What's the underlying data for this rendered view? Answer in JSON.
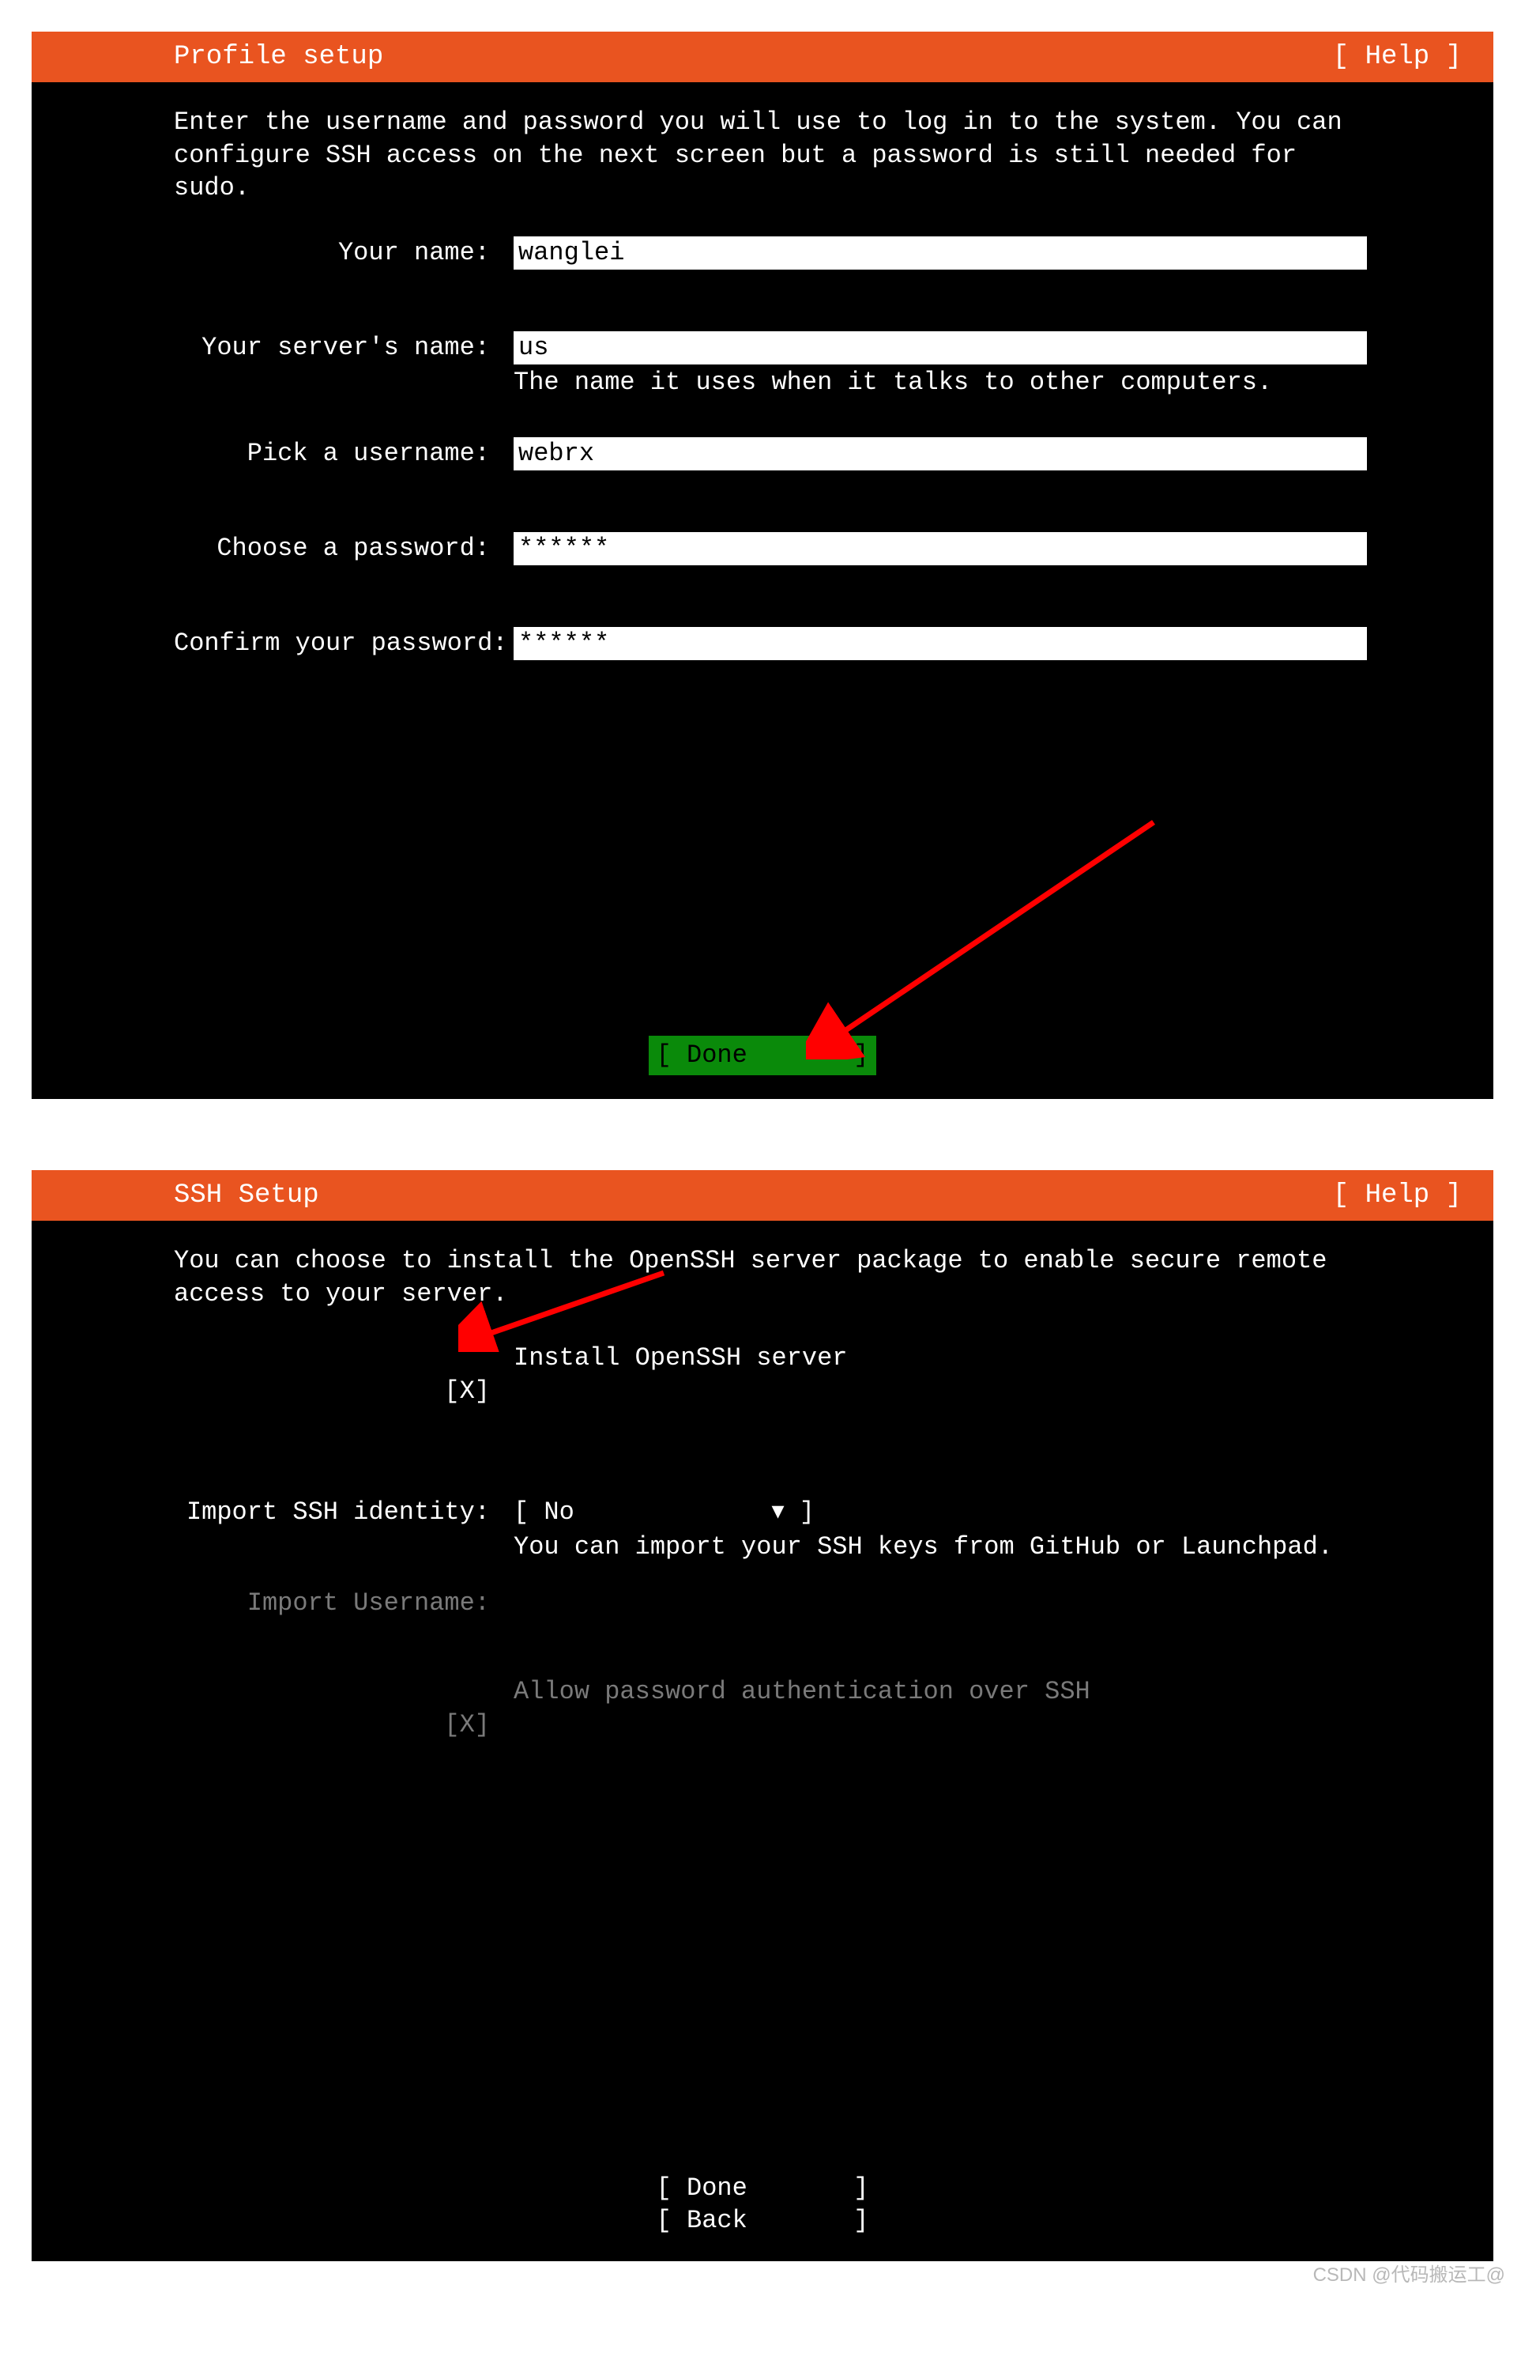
{
  "profile": {
    "title": "Profile setup",
    "help": "[ Help ]",
    "intro": "Enter the username and password you will use to log in to the system. You can configure SSH access on the next screen but a password is still needed for sudo.",
    "name_label": "Your name:",
    "name_value": "wanglei",
    "server_label": "Your server's name:",
    "server_value": "us",
    "server_hint": "The name it uses when it talks to other computers.",
    "user_label": "Pick a username:",
    "user_value": "webrx",
    "pass_label": "Choose a password:",
    "pass_value": "******",
    "confirm_label": "Confirm your password:",
    "confirm_value": "******",
    "done": "[ Done       ]"
  },
  "ssh": {
    "title": "SSH Setup",
    "help": "[ Help ]",
    "intro": "You can choose to install the OpenSSH server package to enable secure remote access to your server.",
    "install_check": "[X]",
    "install_label": "Install OpenSSH server",
    "import_label": "Import SSH identity:",
    "import_value": "[ No             ▾ ]",
    "import_hint": "You can import your SSH keys from GitHub or Launchpad.",
    "import_user_label": "Import Username:",
    "allow_check": "[X]",
    "allow_label": "Allow password authentication over SSH",
    "done": "[ Done       ]",
    "back": "[ Back       ]"
  },
  "watermark": "CSDN @代码搬运工@"
}
